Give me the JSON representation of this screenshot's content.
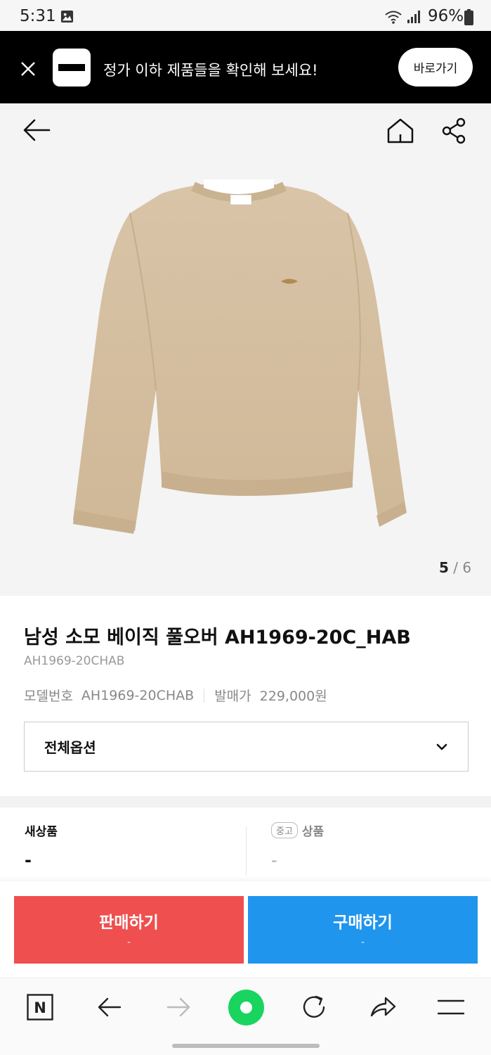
{
  "status": {
    "time": "5:31",
    "battery": "96%"
  },
  "banner": {
    "text": "정가 이하 제품들을 확인해 보세요!",
    "button_label": "바로가기"
  },
  "gallery": {
    "current": "5",
    "separator": "/",
    "total": "6"
  },
  "product": {
    "title": "남성 소모 베이직 풀오버 AH1969-20C_HAB",
    "subcode": "AH1969-20CHAB",
    "model_label": "모델번호",
    "model_value": "AH1969-20CHAB",
    "release_label": "발매가",
    "release_value": "229,000원"
  },
  "options": {
    "selected": "전체옵션"
  },
  "prices": {
    "new_label": "새상품",
    "new_value": "-",
    "used_badge": "중고",
    "used_label": "상품",
    "used_value": "-"
  },
  "actions": {
    "sell_label": "판매하기",
    "sell_sub": "-",
    "buy_label": "구매하기",
    "buy_sub": "-"
  },
  "browser_nav": {
    "n_label": "N"
  },
  "colors": {
    "sell": "#ef4f4f",
    "buy": "#1f95ee",
    "banner_bg": "#000000",
    "nav_accent": "#19d45f"
  }
}
